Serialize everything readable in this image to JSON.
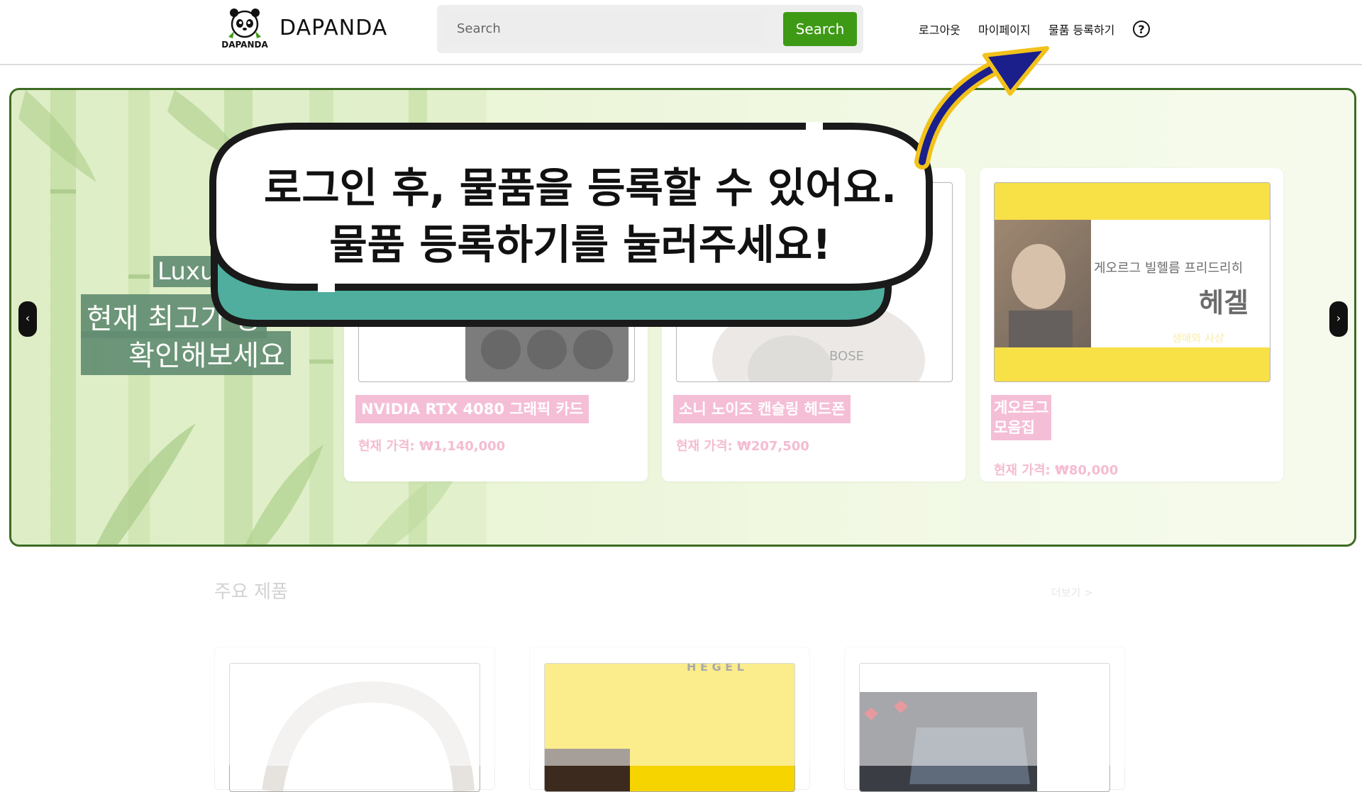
{
  "header": {
    "brand": "DAPANDA",
    "logo_text": "DAPANDA",
    "search": {
      "placeholder": "Search",
      "button_label": "Search"
    },
    "nav": {
      "logout": "로그아웃",
      "mypage": "마이페이지",
      "register": "물품 등록하기",
      "help_icon": "question-circle-icon"
    }
  },
  "banner": {
    "tag_line1": "Luxu",
    "tag_line2": "현재 최고가 상",
    "tag_line3": "확인해보세요",
    "prev_icon": "‹",
    "next_icon": "›",
    "cards": [
      {
        "title": "NVIDIA RTX 4080 그래픽 카드",
        "price": "현재 가격: ₩1,140,000"
      },
      {
        "title": "소니 노이즈 캔슬링 헤드폰",
        "price": "현재 가격: ₩207,500"
      },
      {
        "title_line1": "게오르그",
        "title_line2": "모음집",
        "price": "현재 가격: ₩80,000",
        "book": {
          "subtitle": "게오르그 빌헬름 프리드리히",
          "title": "헤겔",
          "tagline": "생애와 사상"
        }
      }
    ]
  },
  "section": {
    "title": "주요 제품",
    "more": "더보기 >"
  },
  "tutorial": {
    "line1": "로그인 후, 물품을 등록할 수 있어요.",
    "line2": "물품 등록하기를 눌러주세요!"
  },
  "colors": {
    "accent_green": "#3e9a15",
    "banner_border": "#3d6b24",
    "title_pink": "#f2a6c8",
    "bubble_teal": "#4fae9e",
    "arrow_blue": "#1a1f8c",
    "arrow_yellow": "#f2c21b"
  }
}
